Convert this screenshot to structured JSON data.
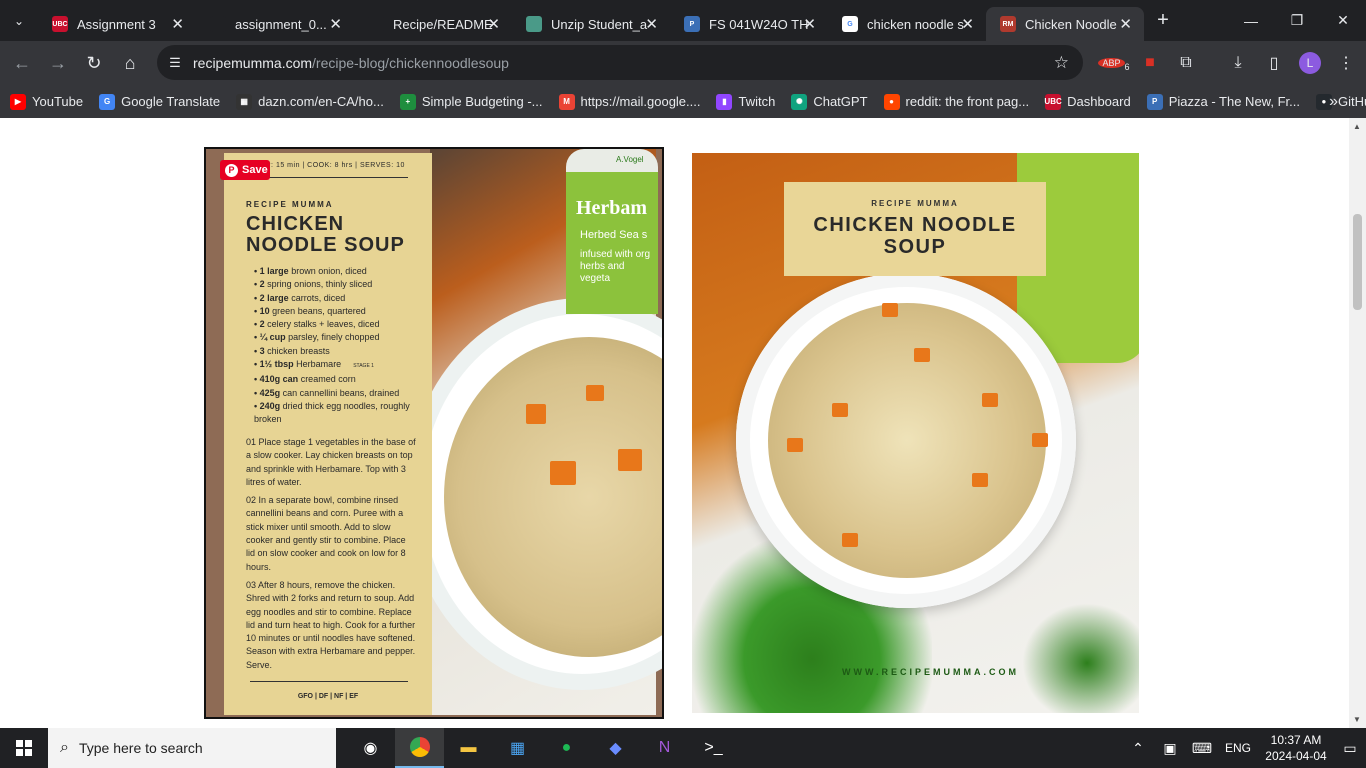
{
  "tabs": [
    {
      "title": "Assignment 3",
      "fav_color": "#c8102e",
      "fav_text": "UBC"
    },
    {
      "title": "assignment_0...",
      "fav_color": "#202124",
      "fav_text": ""
    },
    {
      "title": "Recipe/README",
      "fav_color": "#202124",
      "fav_text": ""
    },
    {
      "title": "Unzip Student_a",
      "fav_color": "#4a9a88",
      "fav_text": ""
    },
    {
      "title": "FS 041W24O TH",
      "fav_color": "#3b6fb6",
      "fav_text": "P"
    },
    {
      "title": "chicken noodle s",
      "fav_color": "#ffffff",
      "fav_text": "G"
    },
    {
      "title": "Chicken Noodle",
      "fav_color": "#b03a2e",
      "fav_text": "RM"
    }
  ],
  "new_tab_symbol": "+",
  "address": {
    "host": "recipemumma.com",
    "path": "/recipe-blog/chickennoodlesoup"
  },
  "extension_badge": "6",
  "avatar_letter": "L",
  "bookmarks": [
    {
      "label": "YouTube",
      "color": "#ff0000",
      "text": "▶"
    },
    {
      "label": "Google Translate",
      "color": "#4285f4",
      "text": "G"
    },
    {
      "label": "dazn.com/en-CA/ho...",
      "color": "#333333",
      "text": "▦"
    },
    {
      "label": "Simple Budgeting -...",
      "color": "#1e8e3e",
      "text": "+"
    },
    {
      "label": "https://mail.google....",
      "color": "#ea4335",
      "text": "M"
    },
    {
      "label": "Twitch",
      "color": "#9146ff",
      "text": "▮"
    },
    {
      "label": "ChatGPT",
      "color": "#10a37f",
      "text": "✺"
    },
    {
      "label": "reddit: the front pag...",
      "color": "#ff4500",
      "text": "●"
    },
    {
      "label": "Dashboard",
      "color": "#c8102e",
      "text": "UBC"
    },
    {
      "label": "Piazza - The New, Fr...",
      "color": "#3b6fb6",
      "text": "P"
    },
    {
      "label": "GitHub",
      "color": "#24292e",
      "text": "●"
    }
  ],
  "recipe_card": {
    "meta": "PREP: 15 min  |  COOK: 8 hrs  |  SERVES: 10",
    "brand": "RECIPE MUMMA",
    "title_line1": "CHICKEN",
    "title_line2": "NOODLE SOUP",
    "pin_label": "Save",
    "ingredients": [
      {
        "qty": "1 large",
        "item": " brown onion, diced"
      },
      {
        "qty": "2",
        "item": " spring onions, thinly sliced"
      },
      {
        "qty": "2 large",
        "item": " carrots, diced"
      },
      {
        "qty": "10",
        "item": " green beans, quartered"
      },
      {
        "qty": "2",
        "item": " celery stalks + leaves, diced"
      },
      {
        "qty": "¼ cup",
        "item": " parsley, finely chopped"
      },
      {
        "qty": "3",
        "item": " chicken breasts"
      },
      {
        "qty": "1½ tbsp",
        "item": " Herbamare"
      },
      {
        "qty": "410g can",
        "item": " creamed corn"
      },
      {
        "qty": "425g",
        "item": " can cannellini beans, drained"
      },
      {
        "qty": "240g",
        "item": " dried thick egg noodles, roughly broken"
      }
    ],
    "stage_label": "STAGE 1",
    "step1": "01  Place stage 1 vegetables in the base of a slow cooker. Lay chicken breasts on top and sprinkle with Herbamare. Top with 3 litres of water.",
    "step2": "02  In a separate bowl, combine rinsed cannellini beans and corn. Puree with a stick mixer until smooth. Add to slow cooker and gently stir to combine. Place lid on slow cooker and cook on low for 8 hours.",
    "step3": "03  After 8 hours, remove the chicken. Shred with 2 forks and return to soup. Add egg noodles and stir to combine. Replace lid and turn heat to high. Cook for a further 10 minutes or until noodles have softened. Season with extra Herbamare and pepper. Serve.",
    "footer": "GFO  |  DF  |  NF  |  EF",
    "bottle_brand": "A.Vogel",
    "bottle_name": "Herbam",
    "bottle_sub": "Herbed Sea s",
    "bottle_desc": "infused with org herbs and vegeta"
  },
  "hero_image": {
    "brand": "RECIPE MUMMA",
    "title_line1": "CHICKEN NOODLE",
    "title_line2": "SOUP",
    "watermark": "WWW.RECIPEMUMMA.COM"
  },
  "taskbar": {
    "search_placeholder": "Type here to search",
    "language": "ENG",
    "time": "10:37 AM",
    "date": "2024-04-04"
  }
}
